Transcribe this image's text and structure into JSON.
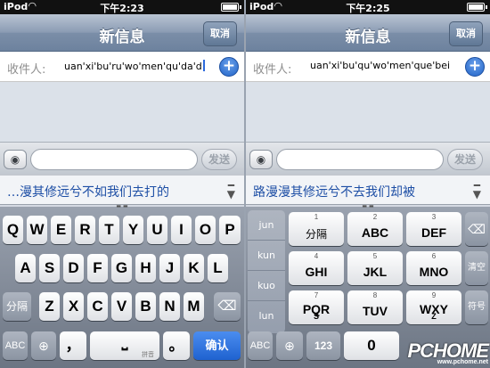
{
  "left": {
    "status": {
      "carrier": "iPod",
      "time": "下午2:23"
    },
    "nav": {
      "title": "新信息",
      "cancel": "取消"
    },
    "recipient": {
      "label": "收件人:",
      "value": "uan'xi'bu'ru'wo'men'qu'da'd"
    },
    "send": "发送",
    "candidates": "…漫其修远兮不如我们去打的",
    "keyboard": {
      "row1": [
        "Q",
        "W",
        "E",
        "R",
        "T",
        "Y",
        "U",
        "I",
        "O",
        "P"
      ],
      "row2": [
        "A",
        "S",
        "D",
        "F",
        "G",
        "H",
        "J",
        "K",
        "L"
      ],
      "row3": [
        "Z",
        "X",
        "C",
        "V",
        "B",
        "N",
        "M"
      ],
      "separator": "分隔",
      "abc": "ABC",
      "comma": "，",
      "period": "。",
      "space_label": "拼音",
      "confirm": "确认"
    }
  },
  "right": {
    "status": {
      "carrier": "iPod",
      "time": "下午2:25"
    },
    "nav": {
      "title": "新信息",
      "cancel": "取消"
    },
    "recipient": {
      "label": "收件人:",
      "value": "uan'xi'bu'qu'wo'men'que'bei"
    },
    "send": "发送",
    "candidates": "路漫漫其修远兮不去我们却被",
    "keyboard": {
      "side": [
        "jun",
        "kun",
        "kuo",
        "lun"
      ],
      "keys": [
        {
          "main": "分隔",
          "sub": "1"
        },
        {
          "main": "ABC",
          "sub": "2"
        },
        {
          "main": "DEF",
          "sub": "3"
        },
        {
          "main": "GHI",
          "sub": "4"
        },
        {
          "main": "JKL",
          "sub": "5"
        },
        {
          "main": "MNO",
          "sub": "6"
        },
        {
          "main": "PQR",
          "sub": "7",
          "sub2": "S"
        },
        {
          "main": "TUV",
          "sub": "8"
        },
        {
          "main": "WXY",
          "sub": "9",
          "sub2": "Z"
        }
      ],
      "clear": "清空",
      "symbol": "符号",
      "abc": "ABC",
      "num": "123",
      "zero": "0"
    }
  },
  "watermark": {
    "brand": "PCHOME",
    "url": "www.pchome.net"
  },
  "colors": {
    "accent_blue": "#2164c8",
    "candidate_text": "#1d4ea5"
  }
}
